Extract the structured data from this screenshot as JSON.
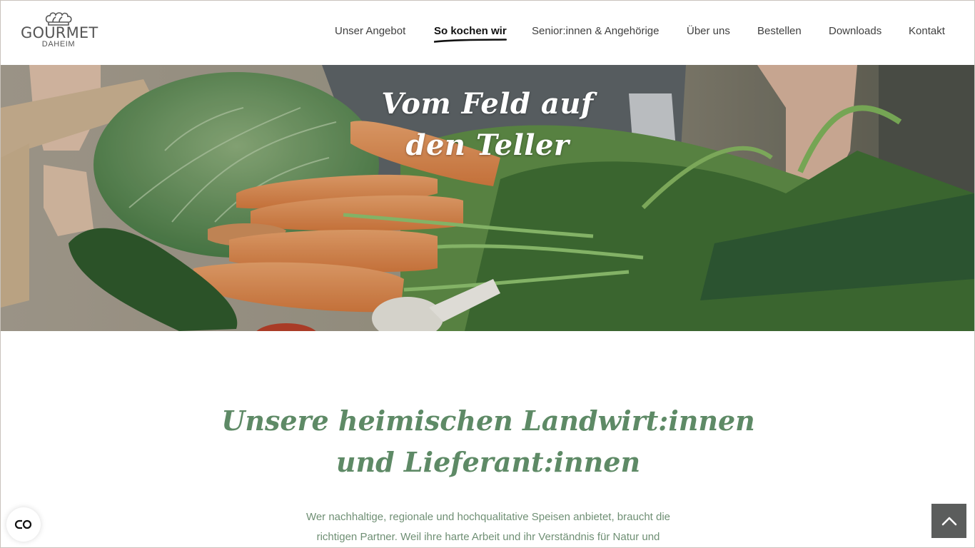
{
  "header": {
    "logo": {
      "brand": "GOURMET",
      "sub": "DAHEIM",
      "icon": "chef-hat-icon"
    },
    "nav": [
      {
        "label": "Unser Angebot",
        "active": false
      },
      {
        "label": "So kochen wir",
        "active": true
      },
      {
        "label": "Senior:innen & Angehörige",
        "active": false
      },
      {
        "label": "Über uns",
        "active": false
      },
      {
        "label": "Bestellen",
        "active": false
      },
      {
        "label": "Downloads",
        "active": false
      },
      {
        "label": "Kontakt",
        "active": false
      }
    ]
  },
  "hero": {
    "title_line1": "Vom Feld auf",
    "title_line2": "den Teller",
    "image": "vegetables-carrots-cabbage-leek-photo"
  },
  "main": {
    "title_line1": "Unsere heimischen Landwirt:innen",
    "title_line2": "und Lieferant:innen",
    "text_line1": "Wer nachhaltige, regionale und hochqualitative Speisen anbietet, braucht die",
    "text_line2": "richtigen Partner. Weil ihre harte Arbeit und ihr Verständnis für Natur und"
  },
  "floating": {
    "accessibility_icon": "accessibility-toggle-icon",
    "back_to_top_icon": "chevron-up-icon"
  },
  "colors": {
    "accent_green": "#5e8a66",
    "text_green": "#6f8f74",
    "nav_text": "#3f3f3f",
    "back_to_top_bg": "#5b5d5c"
  }
}
